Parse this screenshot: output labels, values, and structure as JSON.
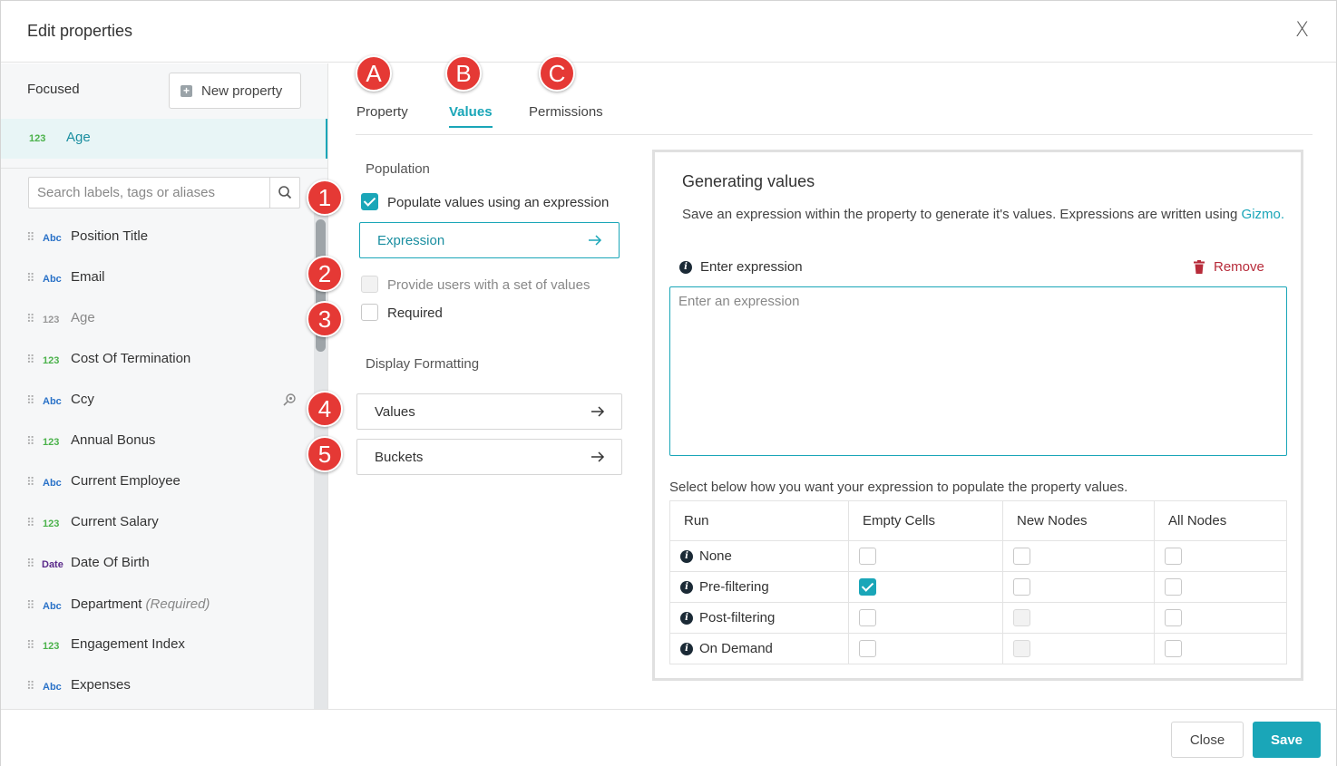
{
  "dialog": {
    "title": "Edit properties",
    "close_label": "X"
  },
  "sidebar": {
    "focused_label": "Focused",
    "new_property_label": "New property",
    "focused_item": {
      "type": "123",
      "name": "Age"
    },
    "search_placeholder": "Search labels, tags or aliases",
    "items": [
      {
        "type": "Abc",
        "name": "Position Title"
      },
      {
        "type": "Abc",
        "name": "Email"
      },
      {
        "type": "123",
        "name": "Age"
      },
      {
        "type": "123",
        "name": "Cost Of Termination"
      },
      {
        "type": "Abc",
        "name": "Ccy"
      },
      {
        "type": "123",
        "name": "Annual Bonus"
      },
      {
        "type": "Abc",
        "name": "Current Employee"
      },
      {
        "type": "123",
        "name": "Current Salary"
      },
      {
        "type": "Date",
        "name": "Date Of Birth"
      },
      {
        "type": "Abc",
        "name": "Department",
        "suffix": "(Required)"
      },
      {
        "type": "123",
        "name": "Engagement Index"
      },
      {
        "type": "Abc",
        "name": "Expenses"
      }
    ]
  },
  "tabs": [
    {
      "badge": "A",
      "label": "Property"
    },
    {
      "badge": "B",
      "label": "Values"
    },
    {
      "badge": "C",
      "label": "Permissions"
    }
  ],
  "population": {
    "heading": "Population",
    "populate_label": "Populate values using an expression",
    "expression_button": "Expression",
    "provide_label": "Provide users with a set of values",
    "required_label": "Required",
    "badges": [
      "1",
      "2",
      "3",
      "4",
      "5"
    ]
  },
  "display_formatting": {
    "heading": "Display Formatting",
    "values_button": "Values",
    "buckets_button": "Buckets"
  },
  "generating": {
    "title": "Generating values",
    "description": "Save an expression within the property to generate it's values. Expressions are written using",
    "link": "Gizmo.",
    "enter_label": "Enter expression",
    "remove_label": "Remove",
    "placeholder": "Enter an expression",
    "select_text": "Select below how you want your expression to populate the property values.",
    "columns": [
      "Run",
      "Empty Cells",
      "New Nodes",
      "All Nodes"
    ],
    "rows": [
      {
        "name": "None",
        "empty": "unchecked",
        "new": "unchecked",
        "all": "unchecked"
      },
      {
        "name": "Pre-filtering",
        "empty": "checked",
        "new": "unchecked",
        "all": "unchecked"
      },
      {
        "name": "Post-filtering",
        "empty": "unchecked",
        "new": "disabled",
        "all": "unchecked"
      },
      {
        "name": "On Demand",
        "empty": "unchecked",
        "new": "disabled",
        "all": "unchecked"
      }
    ]
  },
  "footer": {
    "close_label": "Close",
    "save_label": "Save"
  },
  "colors": {
    "accent": "#1aa6b8",
    "badge": "#e53935",
    "remove": "#b72b3a"
  }
}
